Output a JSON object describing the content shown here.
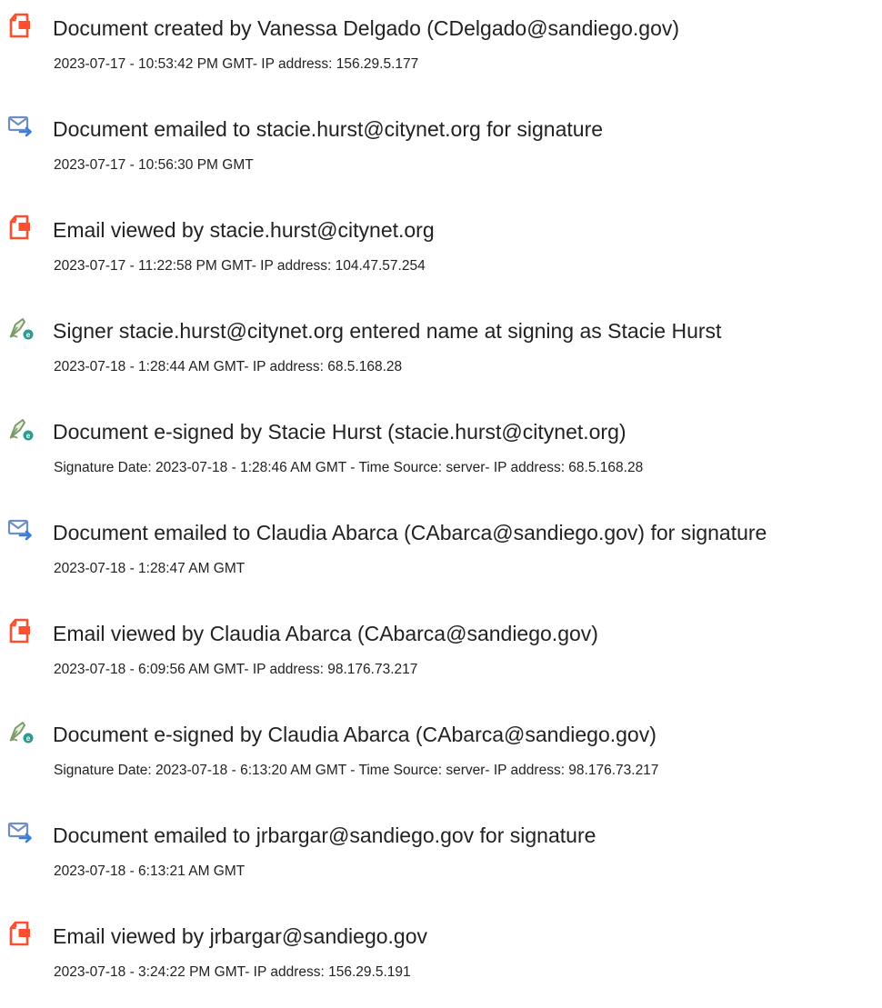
{
  "audit_events": [
    {
      "icon": "document-created-icon",
      "title": "Document created by Vanessa Delgado (CDelgado@sandiego.gov)",
      "detail": "2023-07-17 - 10:53:42 PM GMT- IP address: 156.29.5.177"
    },
    {
      "icon": "email-sent-icon",
      "title": "Document emailed to stacie.hurst@citynet.org for signature",
      "detail": "2023-07-17 - 10:56:30 PM GMT"
    },
    {
      "icon": "document-viewed-icon",
      "title": "Email viewed by stacie.hurst@citynet.org",
      "detail": "2023-07-17 - 11:22:58 PM GMT- IP address: 104.47.57.254"
    },
    {
      "icon": "esign-pen-icon",
      "title": "Signer stacie.hurst@citynet.org entered name at signing as Stacie Hurst",
      "detail": "2023-07-18 - 1:28:44 AM GMT- IP address: 68.5.168.28"
    },
    {
      "icon": "esign-pen-icon",
      "title": "Document e-signed by Stacie Hurst (stacie.hurst@citynet.org)",
      "detail": "Signature Date: 2023-07-18 - 1:28:46 AM GMT - Time Source: server- IP address: 68.5.168.28"
    },
    {
      "icon": "email-sent-icon",
      "title": "Document emailed to Claudia Abarca (CAbarca@sandiego.gov) for signature",
      "detail": "2023-07-18 - 1:28:47 AM GMT"
    },
    {
      "icon": "document-viewed-icon",
      "title": "Email viewed by Claudia Abarca (CAbarca@sandiego.gov)",
      "detail": "2023-07-18 - 6:09:56 AM GMT- IP address: 98.176.73.217"
    },
    {
      "icon": "esign-pen-icon",
      "title": "Document e-signed by Claudia Abarca (CAbarca@sandiego.gov)",
      "detail": "Signature Date: 2023-07-18 - 6:13:20 AM GMT - Time Source: server- IP address: 98.176.73.217"
    },
    {
      "icon": "email-sent-icon",
      "title": "Document emailed to jrbargar@sandiego.gov for signature",
      "detail": "2023-07-18 - 6:13:21 AM GMT"
    },
    {
      "icon": "document-viewed-icon",
      "title": "Email viewed by jrbargar@sandiego.gov",
      "detail": "2023-07-18 - 3:24:22 PM GMT- IP address: 156.29.5.191"
    }
  ],
  "colors": {
    "document_icon": "#ff4d2e",
    "email_icon": "#6f8fc4",
    "email_arrow": "#3b7dd8",
    "pen_icon": "#7d9a6a",
    "pen_badge": "#2a9d8f",
    "text": "#222222"
  }
}
